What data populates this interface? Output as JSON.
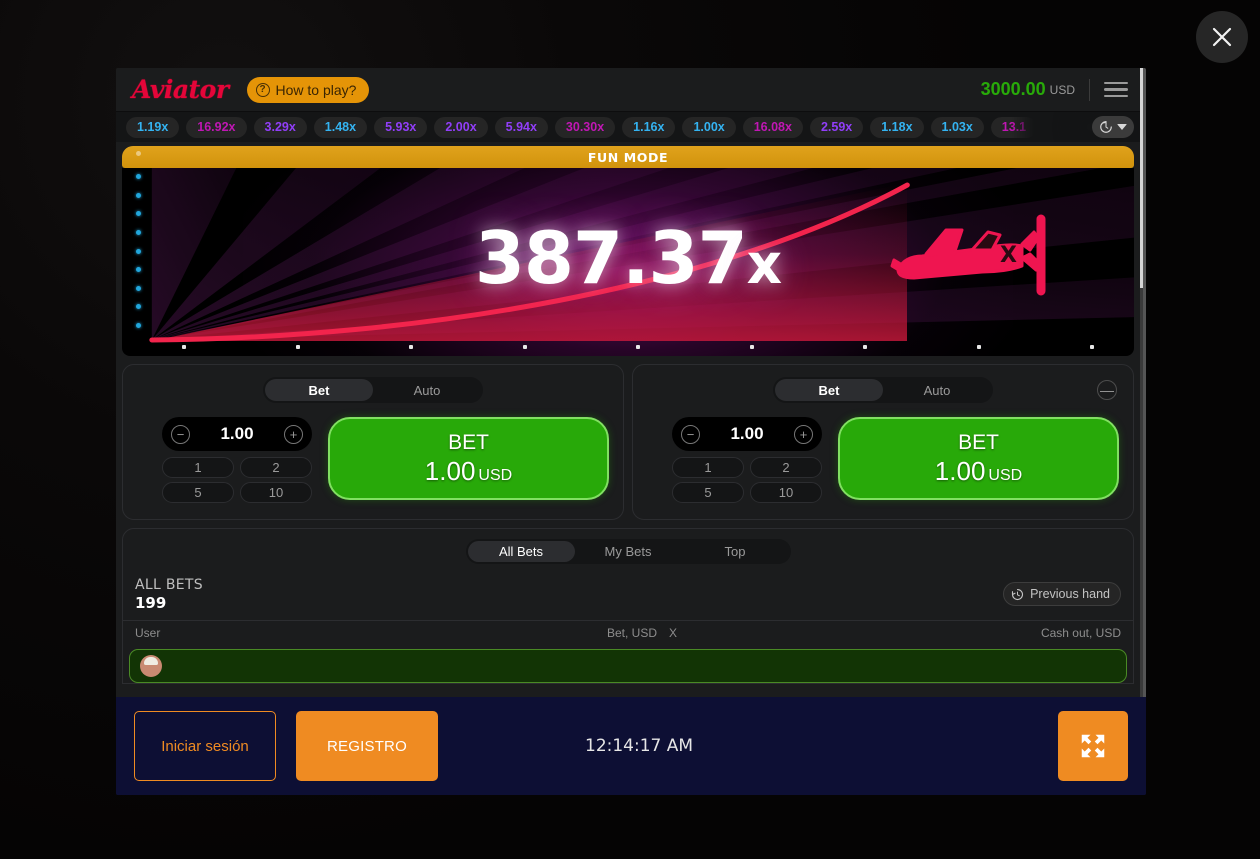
{
  "close_label": "×",
  "header": {
    "logo": "Aviator",
    "how_to_play": "How to play?",
    "balance": "3000.00",
    "currency": "USD"
  },
  "history": {
    "items": [
      {
        "value": "1.19x",
        "tone": "blue"
      },
      {
        "value": "16.92x",
        "tone": "pink"
      },
      {
        "value": "3.29x",
        "tone": "purple"
      },
      {
        "value": "1.48x",
        "tone": "blue"
      },
      {
        "value": "5.93x",
        "tone": "purple"
      },
      {
        "value": "2.00x",
        "tone": "purple"
      },
      {
        "value": "5.94x",
        "tone": "purple"
      },
      {
        "value": "30.30x",
        "tone": "pink"
      },
      {
        "value": "1.16x",
        "tone": "blue"
      },
      {
        "value": "1.00x",
        "tone": "blue"
      },
      {
        "value": "16.08x",
        "tone": "pink"
      },
      {
        "value": "2.59x",
        "tone": "purple"
      },
      {
        "value": "1.18x",
        "tone": "blue"
      },
      {
        "value": "1.03x",
        "tone": "blue"
      },
      {
        "value": "13.1",
        "tone": "pink"
      }
    ],
    "history_icon": "clock-history-icon",
    "caret_icon": "chevron-down-icon"
  },
  "game": {
    "fun_mode": "FUN MODE",
    "multiplier": "387.37",
    "multiplier_suffix": "x",
    "plane_icon": "plane-icon"
  },
  "bet_panels": [
    {
      "tab_bet": "Bet",
      "tab_auto": "Auto",
      "active_tab": "Bet",
      "stake": "1.00",
      "minus_icon": "minus-circle-icon",
      "plus_icon": "plus-circle-icon",
      "quick": [
        "1",
        "2",
        "5",
        "10"
      ],
      "button_title": "BET",
      "button_amount": "1.00",
      "button_currency": "USD",
      "has_minimize": false
    },
    {
      "tab_bet": "Bet",
      "tab_auto": "Auto",
      "active_tab": "Bet",
      "stake": "1.00",
      "minus_icon": "minus-circle-icon",
      "plus_icon": "plus-circle-icon",
      "quick": [
        "1",
        "2",
        "5",
        "10"
      ],
      "button_title": "BET",
      "button_amount": "1.00",
      "button_currency": "USD",
      "has_minimize": true,
      "minimize_label": "—"
    }
  ],
  "bets": {
    "tabs": [
      "All Bets",
      "My Bets",
      "Top"
    ],
    "active_tab": "All Bets",
    "title": "ALL BETS",
    "count": "199",
    "previous_hand": "Previous hand",
    "previous_hand_icon": "clock-rewind-icon",
    "columns": {
      "user": "User",
      "bet": "Bet, USD",
      "x": "X",
      "cashout": "Cash out, USD"
    }
  },
  "footer": {
    "login": "Iniciar sesión",
    "register": "REGISTRO",
    "clock": "12:14:17 AM",
    "fullscreen_icon": "fullscreen-expand-icon"
  },
  "colors": {
    "accent_red": "#e50539",
    "orange": "#e59407",
    "green": "#28a909",
    "blue": "#34b3f1",
    "pink": "#c017b4",
    "purple": "#913ef8",
    "footer_bg": "#0d0f34",
    "register_orange": "#ef8b22"
  }
}
